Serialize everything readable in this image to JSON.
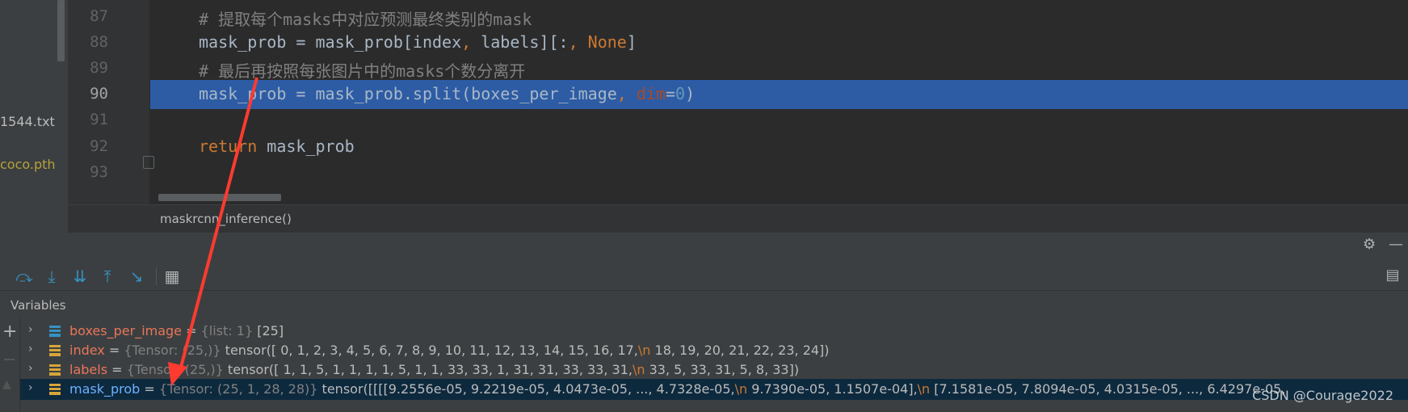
{
  "project_tree": {
    "files": [
      "1544.txt",
      "coco.pth"
    ]
  },
  "editor": {
    "lines": [
      {
        "num": "87"
      },
      {
        "num": "88"
      },
      {
        "num": "89"
      },
      {
        "num": "90"
      },
      {
        "num": "91"
      },
      {
        "num": "92"
      },
      {
        "num": "93"
      }
    ],
    "code": {
      "l87_comment": "# 提取每个masks中对应预测最终类别的mask",
      "l88_a": "mask_prob = mask_prob[index",
      "l88_comma": ",",
      "l88_b": " labels][:",
      "l88_comma2": ",",
      "l88_none": " None",
      "l88_c": "]",
      "l89_comment": "# 最后再按照每张图片中的masks个数分离开",
      "l90_a": "mask_prob = mask_prob.split(boxes_per_image",
      "l90_comma": ",",
      "l90_param": " dim",
      "l90_eq": "=",
      "l90_num": "0",
      "l90_close": ")",
      "l92_kw": "return",
      "l92_rest": " mask_prob"
    },
    "breadcrumb": "maskrcnn_inference()"
  },
  "debug": {
    "variables_title": "Variables",
    "icons": [
      "step-over-icon",
      "step-into-icon",
      "step-into-my-code-icon",
      "step-out-icon",
      "run-to-cursor-icon",
      "evaluate-expression-icon"
    ],
    "variables": [
      {
        "name": "boxes_per_image",
        "eq": " = ",
        "type": "{list: 1}",
        "value": " [25]"
      },
      {
        "name": "index",
        "eq": " = ",
        "type": "{Tensor: (25,)}",
        "value": " tensor([ 0,  1,  2,  3,  4,  5,  6,  7,  8,  9, 10, 11, 12, 13, 14, 15, 16, 17,",
        "nl": "\\n",
        "value2": "        18, 19, 20, 21, 22, 23, 24])"
      },
      {
        "name": "labels",
        "eq": " = ",
        "type": "{Tensor: (25,)}",
        "value": " tensor([ 1,  1,  5,  1,  1,  1,  1,  5,  1,  1, 33, 33,  1, 31, 31, 33, 33, 31,",
        "nl": "\\n",
        "value2": "        33,  5, 33, 31,  5,  8, 33])"
      },
      {
        "name": "mask_prob",
        "eq": " = ",
        "type": "{Tensor: (25, 1, 28, 28)}",
        "value": " tensor([[[[9.2556e-05, 9.2219e-05, 4.0473e-05,  ..., 4.7328e-05,",
        "nl": "\\n",
        "value2": "          9.7390e-05, 1.1507e-04],",
        "nl2": "\\n",
        "value3": "          [7.1581e-05, 7.8094e-05, 4.0315e-05,  ..., 6.4297e-05,"
      }
    ]
  },
  "watermark": "CSDN @Courage2022",
  "colors": {
    "selection": "#2d5ca5",
    "annotation": "#ff3b30"
  }
}
